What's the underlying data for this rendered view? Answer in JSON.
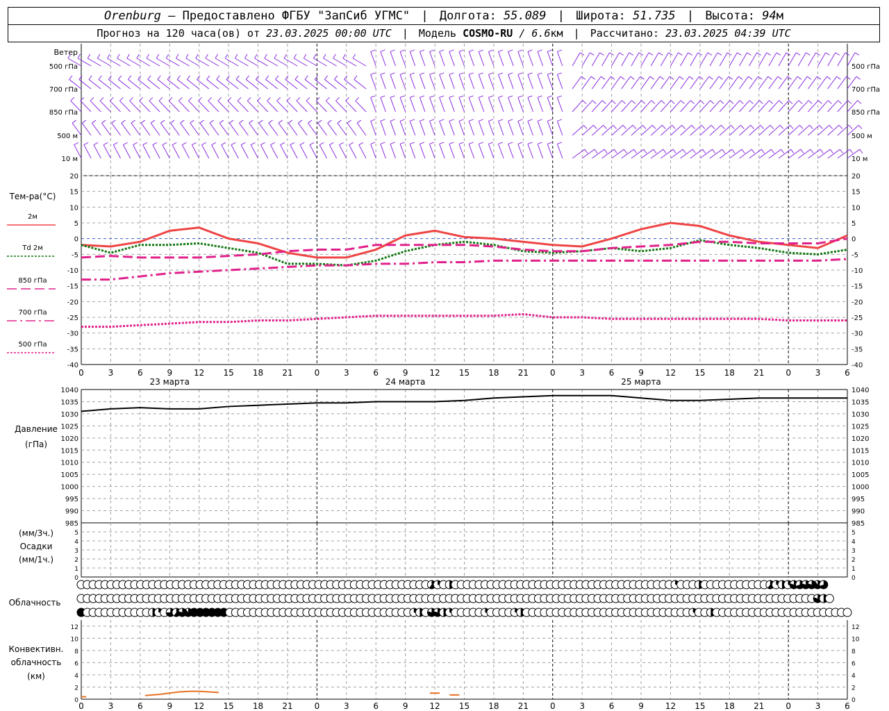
{
  "header": {
    "line1": {
      "city": "Orenburg",
      "provided_by": "— Предоставлено ФГБУ \"ЗапСиб УГМС\"",
      "lon_label": "Долгота:",
      "lon_value": "55.089",
      "lat_label": "Широта:",
      "lat_value": "51.735",
      "alt_label": "Высота:",
      "alt_value": "94",
      "alt_unit": "м"
    },
    "line2": {
      "forecast_label": "Прогноз на 120 часа(ов) от",
      "forecast_start": "23.03.2025 00:00 UTC",
      "model_label": "Модель",
      "model_name": "COSMO-RU",
      "model_res": "/ 6.6",
      "model_res_unit": "км",
      "calc_label": "Рассчитано:",
      "calc_time": "23.03.2025 04:39 UTC"
    }
  },
  "colors": {
    "wind": "#8a2be2",
    "t2m": "#ee4444",
    "td2m": "#117711",
    "t850": "#e0208a",
    "t700": "#e0208a",
    "t500": "#e0208a",
    "pressure": "#000000",
    "convective": "#e87020",
    "grid": "#a0a0a0",
    "zero_line": "#3355cc"
  },
  "time_axis": {
    "hour_ticks": [
      "0",
      "3",
      "6",
      "9",
      "12",
      "15",
      "18",
      "21",
      "0",
      "3",
      "6",
      "9",
      "12",
      "15",
      "18",
      "21",
      "0",
      "3",
      "6",
      "9",
      "12",
      "15",
      "18",
      "21",
      "0",
      "3",
      "6"
    ],
    "day_labels": [
      "23 марта",
      "24 марта",
      "25 марта"
    ]
  },
  "chart_data": [
    {
      "type": "wind_barbs",
      "panel_label": "Ветер",
      "levels": [
        "500 гПа",
        "700 гПа",
        "850 гПа",
        "500 м",
        "10 м"
      ],
      "direction_note": "barbs drawn every 1h, shaft along wind direction"
    },
    {
      "type": "line",
      "panel_label": "Тем-ра(°С)",
      "ylim": [
        -40,
        20
      ],
      "yticks": [
        "20",
        "15",
        "10",
        "5",
        "0",
        "-5",
        "-10",
        "-15",
        "-20",
        "-25",
        "-30",
        "-35",
        "-40"
      ],
      "x": [
        0,
        3,
        6,
        9,
        12,
        15,
        18,
        21,
        24,
        27,
        30,
        33,
        36,
        39,
        42,
        45,
        48,
        51,
        54,
        57,
        60,
        63,
        66,
        69,
        72,
        75,
        78
      ],
      "series": [
        {
          "name": "2м",
          "style": "solid",
          "values": [
            -2,
            -2.5,
            -1,
            2.5,
            3.5,
            0,
            -1.5,
            -4.5,
            -6,
            -6,
            -3.5,
            1,
            2.5,
            0.5,
            0,
            -1,
            -2,
            -2.5,
            0,
            3,
            5,
            4,
            1,
            -1,
            -2,
            -3,
            1
          ]
        },
        {
          "name": "Td 2м",
          "style": "dotted",
          "values": [
            -2,
            -4.5,
            -2,
            -2,
            -1.5,
            -3,
            -4.5,
            -8,
            -8,
            -8.5,
            -7,
            -4,
            -2,
            -1,
            -2,
            -4,
            -4.5,
            -4,
            -3,
            -4,
            -3,
            -0.5,
            -2,
            -3,
            -4.5,
            -5,
            -3.5
          ]
        },
        {
          "name": "850 гПа",
          "style": "dash",
          "values": [
            -6,
            -5.5,
            -6,
            -6,
            -6,
            -5.5,
            -5,
            -4,
            -3.5,
            -3.5,
            -2,
            -2,
            -2,
            -2,
            -2.5,
            -3.5,
            -4,
            -4,
            -3,
            -2.5,
            -2,
            -1,
            -1,
            -1.5,
            -1.5,
            -1.5,
            0
          ]
        },
        {
          "name": "700 гПа",
          "style": "dashdot",
          "values": [
            -13,
            -13,
            -12,
            -11,
            -10.5,
            -10,
            -9.5,
            -9,
            -8.5,
            -8.5,
            -8,
            -8,
            -7.5,
            -7.5,
            -7,
            -7,
            -7,
            -7,
            -7,
            -7,
            -7,
            -7,
            -7,
            -7,
            -7,
            -7,
            -6.5
          ]
        },
        {
          "name": "500 гПа",
          "style": "dotted",
          "values": [
            -28,
            -28,
            -27.5,
            -27,
            -26.5,
            -26.5,
            -26,
            -26,
            -25.5,
            -25,
            -24.5,
            -24.5,
            -24.5,
            -24.5,
            -24.5,
            -24,
            -25,
            -25,
            -25.5,
            -25.5,
            -25.5,
            -25.5,
            -25.5,
            -25.5,
            -26,
            -26,
            -26
          ]
        }
      ]
    },
    {
      "type": "line",
      "panel_label_1": "Давление",
      "panel_label_2": "(гПа)",
      "ylim": [
        985,
        1040
      ],
      "yticks": [
        "1040",
        "1035",
        "1030",
        "1025",
        "1020",
        "1015",
        "1010",
        "1005",
        "1000",
        "995",
        "990",
        "985"
      ],
      "x": [
        0,
        3,
        6,
        9,
        12,
        15,
        18,
        21,
        24,
        27,
        30,
        33,
        36,
        39,
        42,
        45,
        48,
        51,
        54,
        57,
        60,
        63,
        66,
        69,
        72,
        75,
        78
      ],
      "series": [
        {
          "name": "Давление",
          "values": [
            1031,
            1032,
            1032.5,
            1032,
            1032,
            1033,
            1033.5,
            1034,
            1034.5,
            1034.5,
            1035,
            1035,
            1035,
            1035.5,
            1036.5,
            1037,
            1037.5,
            1037.5,
            1037.5,
            1036.5,
            1035.5,
            1035.5,
            1036,
            1036.5,
            1036.5,
            1036.5,
            1036.5
          ]
        }
      ]
    },
    {
      "type": "bar",
      "panel_label_1": "(мм/3ч.)",
      "panel_label_2": "Осадки",
      "panel_label_3": "(мм/1ч.)",
      "ylim": [
        0,
        5
      ],
      "yticks": [
        "5",
        "4",
        "3",
        "2",
        "1",
        "0"
      ],
      "values": []
    },
    {
      "type": "cloud_circles",
      "panel_label": "Облачность",
      "rows": [
        "upper",
        "middle",
        "lower"
      ],
      "fraction_scale": "0-1, 1 = overcast",
      "upper": [
        0,
        0,
        0,
        0,
        0,
        0,
        0,
        0,
        0,
        0,
        0,
        0,
        0,
        0,
        0,
        0,
        0,
        0,
        0,
        0,
        0,
        0,
        0,
        0,
        0,
        0,
        0,
        0,
        0,
        0,
        0,
        0,
        0,
        0,
        0,
        0,
        0,
        0,
        0,
        0,
        0,
        0,
        0,
        0,
        0,
        0,
        0,
        0,
        0,
        0,
        0,
        0,
        0,
        0,
        0,
        0,
        0,
        0,
        0,
        0.6,
        0.3,
        0,
        0.5,
        0,
        0,
        0,
        0,
        0,
        0,
        0,
        0,
        0,
        0,
        0,
        0,
        0,
        0,
        0,
        0,
        0,
        0,
        0,
        0,
        0,
        0,
        0,
        0,
        0,
        0,
        0,
        0,
        0,
        0,
        0,
        0,
        0,
        0,
        0,
        0,
        0,
        0.25,
        0,
        0,
        0,
        0.5,
        0,
        0,
        0,
        0,
        0,
        0,
        0,
        0,
        0,
        0,
        0,
        0.6,
        0.3,
        0.5,
        0.3,
        0.8,
        0.7,
        0.8,
        0.8,
        0.9,
        0.7
      ],
      "middle": [
        0,
        0,
        0,
        0,
        0,
        0,
        0,
        0,
        0,
        0,
        0,
        0,
        0,
        0,
        0,
        0,
        0,
        0,
        0,
        0,
        0,
        0,
        0,
        0,
        0,
        0,
        0,
        0,
        0,
        0,
        0,
        0,
        0,
        0,
        0,
        0,
        0,
        0,
        0,
        0,
        0,
        0,
        0,
        0,
        0,
        0,
        0,
        0,
        0,
        0,
        0,
        0,
        0,
        0,
        0,
        0,
        0,
        0,
        0,
        0,
        0,
        0,
        0,
        0,
        0,
        0,
        0,
        0,
        0,
        0,
        0,
        0,
        0,
        0,
        0,
        0,
        0,
        0,
        0,
        0,
        0,
        0,
        0,
        0,
        0,
        0,
        0,
        0,
        0,
        0,
        0,
        0,
        0,
        0,
        0,
        0,
        0,
        0,
        0,
        0,
        0,
        0,
        0,
        0,
        0,
        0,
        0,
        0,
        0,
        0,
        0,
        0,
        0,
        0,
        0,
        0,
        0,
        0,
        0,
        0,
        0,
        0,
        0,
        0,
        0.8,
        0.5,
        0
      ],
      "lower": [
        1,
        0,
        0,
        0,
        0,
        0,
        0,
        0,
        0,
        0,
        0,
        0,
        0.5,
        0.25,
        0,
        0.75,
        0.6,
        0.8,
        0.9,
        1,
        1,
        1,
        1,
        1,
        1,
        0,
        0,
        0,
        0,
        0,
        0,
        0,
        0,
        0,
        0,
        0,
        0,
        0,
        0,
        0,
        0,
        0,
        0,
        0,
        0,
        0,
        0,
        0,
        0,
        0,
        0,
        0,
        0,
        0,
        0,
        0,
        0.3,
        0.5,
        0,
        0.8,
        0.8,
        0.5,
        0.3,
        0,
        0,
        0,
        0,
        0,
        0.3,
        0,
        0,
        0,
        0,
        0.25,
        0.5,
        0,
        0,
        0,
        0,
        0,
        0,
        0,
        0,
        0,
        0,
        0,
        0,
        0,
        0,
        0,
        0,
        0,
        0,
        0,
        0,
        0,
        0,
        0,
        0,
        0,
        0,
        0,
        0,
        0.3,
        0,
        0,
        0.5,
        0,
        0,
        0,
        0,
        0,
        0,
        0,
        0,
        0,
        0,
        0,
        0,
        0,
        0,
        0,
        0,
        0,
        0,
        0,
        0,
        0,
        0,
        0
      ]
    },
    {
      "type": "line",
      "panel_label_1": "Конвективн.",
      "panel_label_2": "облачность",
      "panel_label_3": "(км)",
      "ylim": [
        0,
        13
      ],
      "yticks": [
        "12",
        "10",
        "8",
        "6",
        "4",
        "2",
        "0"
      ],
      "segments": [
        {
          "x": [
            0,
            0.5
          ],
          "values": [
            0.4,
            0.4
          ]
        },
        {
          "x": [
            6.5,
            8,
            9,
            10,
            11,
            12,
            13,
            14
          ],
          "values": [
            0.6,
            0.8,
            1,
            1.2,
            1.3,
            1.3,
            1.2,
            1.1
          ]
        },
        {
          "x": [
            35.5,
            36.5
          ],
          "values": [
            1,
            1
          ]
        },
        {
          "x": [
            37.5,
            38.5
          ],
          "values": [
            0.7,
            0.7
          ]
        }
      ]
    }
  ]
}
